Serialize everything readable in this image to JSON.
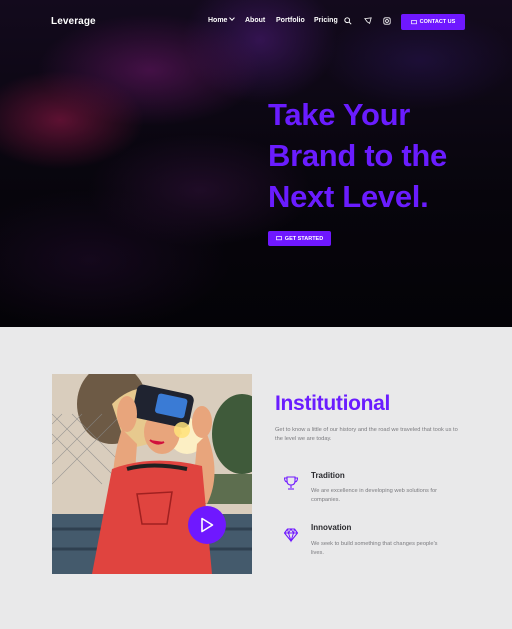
{
  "colors": {
    "accent": "#6f18ff",
    "hero_bg": "#07050c",
    "section_bg": "#e9e9ea"
  },
  "nav": {
    "logo": "Leverage",
    "items": [
      {
        "label": "Home",
        "has_dropdown": true
      },
      {
        "label": "About"
      },
      {
        "label": "Portfolio"
      },
      {
        "label": "Pricing"
      }
    ],
    "icons": [
      "search-icon",
      "pinterest-icon",
      "instagram-icon"
    ],
    "cta": "CONTACT US"
  },
  "hero": {
    "title_lines": [
      "Take Your",
      "Brand to the",
      "Next Level."
    ],
    "button": "GET STARTED"
  },
  "institutional": {
    "title": "Institutional",
    "description": "Get to know a little of our history and the road we traveled that took us to the level we are today.",
    "features": [
      {
        "icon": "trophy-icon",
        "title": "Tradition",
        "text": "We are excellence in developing web solutions for companies."
      },
      {
        "icon": "diamond-icon",
        "title": "Innovation",
        "text": "We seek to build something that changes people's lives."
      }
    ]
  }
}
